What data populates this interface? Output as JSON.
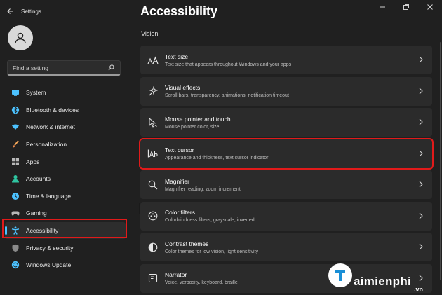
{
  "window": {
    "app_title": "Settings",
    "controls": [
      "minimize-icon",
      "maximize-icon",
      "close-icon"
    ]
  },
  "search": {
    "placeholder": "Find a setting"
  },
  "sidebar": {
    "items": [
      {
        "label": "System",
        "icon": "system-icon",
        "color": "#4cc2ff",
        "selected": false
      },
      {
        "label": "Bluetooth & devices",
        "icon": "bluetooth-icon",
        "color": "#4cc2ff",
        "selected": false
      },
      {
        "label": "Network & internet",
        "icon": "wifi-icon",
        "color": "#4cc2ff",
        "selected": false
      },
      {
        "label": "Personalization",
        "icon": "brush-icon",
        "color": "#f2a65a",
        "selected": false
      },
      {
        "label": "Apps",
        "icon": "apps-icon",
        "color": "#b0b0b0",
        "selected": false
      },
      {
        "label": "Accounts",
        "icon": "accounts-icon",
        "color": "#2fc4a0",
        "selected": false
      },
      {
        "label": "Time & language",
        "icon": "globe-clock-icon",
        "color": "#4cc2ff",
        "selected": false
      },
      {
        "label": "Gaming",
        "icon": "gamepad-icon",
        "color": "#b0b0b0",
        "selected": false
      },
      {
        "label": "Accessibility",
        "icon": "accessibility-icon",
        "color": "#4cc2ff",
        "selected": true
      },
      {
        "label": "Privacy & security",
        "icon": "shield-icon",
        "color": "#8a8a8a",
        "selected": false
      },
      {
        "label": "Windows Update",
        "icon": "update-icon",
        "color": "#4cc2ff",
        "selected": false
      }
    ]
  },
  "main": {
    "page_title": "Accessibility",
    "section_title": "Vision",
    "cards": [
      {
        "title": "Text size",
        "subtitle": "Text size that appears throughout Windows and your apps",
        "icon": "text-size-icon",
        "highlighted": false
      },
      {
        "title": "Visual effects",
        "subtitle": "Scroll bars, transparency, animations, notification timeout",
        "icon": "sparkle-icon",
        "highlighted": false
      },
      {
        "title": "Mouse pointer and touch",
        "subtitle": "Mouse pointer color, size",
        "icon": "mouse-pointer-icon",
        "highlighted": false
      },
      {
        "title": "Text cursor",
        "subtitle": "Appearance and thickness, text cursor indicator",
        "icon": "text-cursor-icon",
        "highlighted": true
      },
      {
        "title": "Magnifier",
        "subtitle": "Magnifier reading, zoom increment",
        "icon": "magnifier-icon",
        "highlighted": false
      },
      {
        "title": "Color filters",
        "subtitle": "Colorblindness filters, grayscale, inverted",
        "icon": "color-filter-icon",
        "highlighted": false
      },
      {
        "title": "Contrast themes",
        "subtitle": "Color themes for low vision, light sensitivity",
        "icon": "contrast-icon",
        "highlighted": false
      },
      {
        "title": "Narrator",
        "subtitle": "Voice, verbosity, keyboard, braille",
        "icon": "narrator-icon",
        "highlighted": false
      }
    ]
  },
  "watermark": {
    "text": "aimienphi",
    "suffix": ".vn"
  },
  "colors": {
    "accent": "#4cc2ff",
    "annotation": "#e11a1a",
    "background": "#202020",
    "card": "#2b2b2b"
  }
}
